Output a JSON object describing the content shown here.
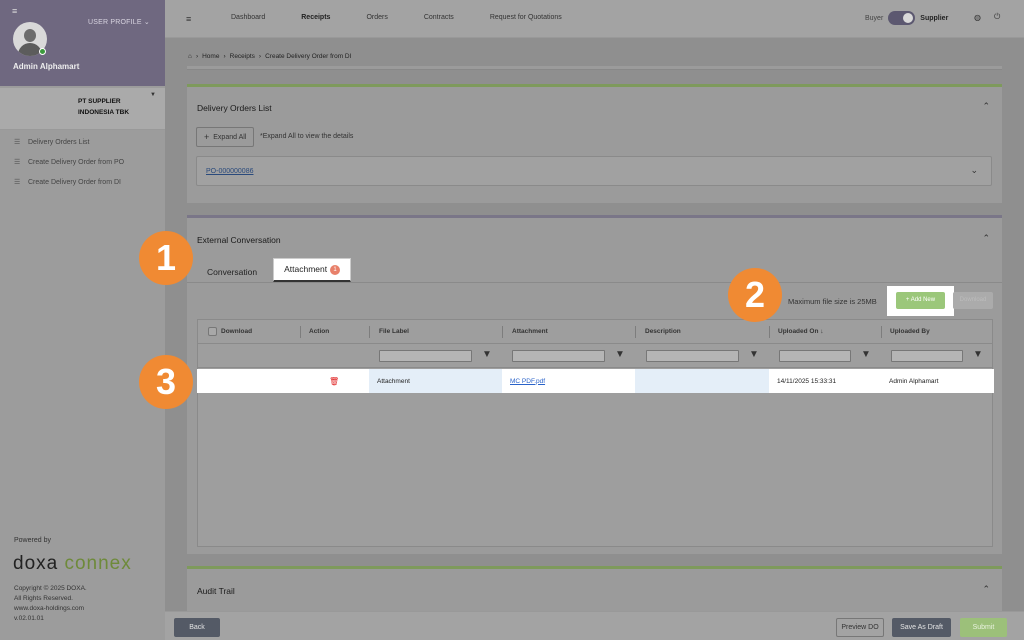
{
  "sidebar": {
    "user_profile_label": "USER PROFILE",
    "user_name": "Admin Alphamart",
    "company_name": "PT SUPPLIER INDONESIA TBK",
    "menu": [
      {
        "label": "Delivery Orders List"
      },
      {
        "label": "Create Delivery Order from PO"
      },
      {
        "label": "Create Delivery Order from DI"
      }
    ],
    "powered_by": "Powered by",
    "brand_part1": "doxa",
    "brand_part2": "connex",
    "copyright": [
      "Copyright © 2025 DOXA.",
      "All Rights Reserved.",
      "www.doxa-holdings.com",
      "v.02.01.01"
    ]
  },
  "topbar": {
    "nav": [
      {
        "label": "Dashboard",
        "active": false
      },
      {
        "label": "Receipts",
        "active": true
      },
      {
        "label": "Orders",
        "active": false
      },
      {
        "label": "Contracts",
        "active": false
      },
      {
        "label": "Request for Quotations",
        "active": false
      }
    ],
    "role_buyer": "Buyer",
    "role_supplier": "Supplier"
  },
  "breadcrumb": {
    "items": [
      "Home",
      "Receipts",
      "Create Delivery Order from DI"
    ]
  },
  "delivery_orders": {
    "title": "Delivery Orders List",
    "expand_label": "Expand All",
    "expand_note": "*Expand All to view the details",
    "po_number": "PO-000000086"
  },
  "conversation": {
    "title": "External Conversation",
    "tabs": [
      {
        "label": "Conversation"
      },
      {
        "label": "Attachment",
        "badge": "1"
      }
    ],
    "max_size": "Maximum file size is 25MB",
    "add_new": "+ Add New",
    "download": "Download",
    "columns": {
      "download": "Download",
      "action": "Action",
      "file_label": "File Label",
      "attachment": "Attachment",
      "description": "Description",
      "uploaded_on": "Uploaded On",
      "uploaded_by": "Uploaded By"
    },
    "row": {
      "file_label": "Attachment",
      "attachment": "MC PDF.pdf",
      "description": "",
      "uploaded_on": "14/11/2025 15:33:31",
      "uploaded_by": "Admin Alphamart"
    }
  },
  "audit": {
    "title": "Audit Trail"
  },
  "callouts": [
    "1",
    "2",
    "3"
  ],
  "footer": {
    "back": "Back",
    "preview": "Preview DO",
    "draft": "Save As Draft",
    "submit": "Submit"
  },
  "colors": {
    "accent_green": "#9bc77a",
    "sidebar_header": "#6f6880",
    "callout_orange": "#f08a33",
    "delete_red": "#e02020"
  }
}
